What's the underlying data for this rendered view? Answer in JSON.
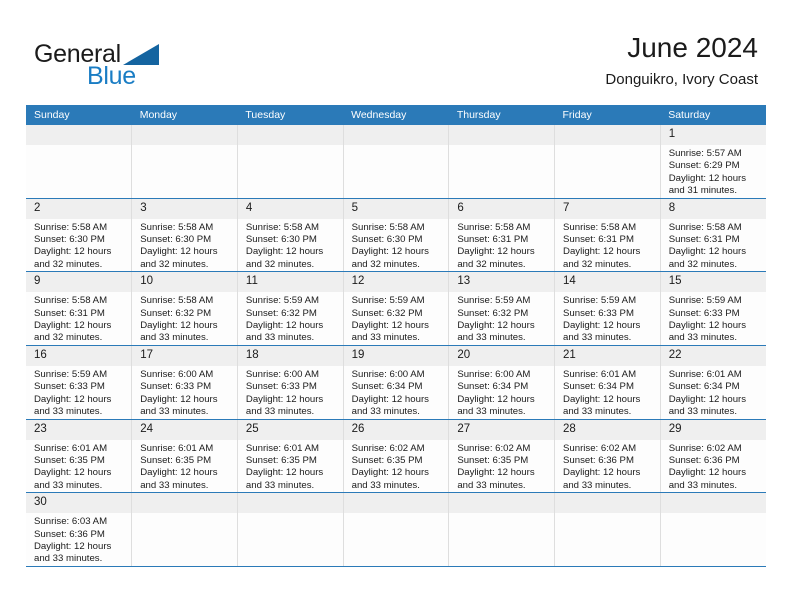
{
  "brand": {
    "name_top": "General",
    "name_bottom": "Blue",
    "accent_color": "#1a7dc4",
    "triangle_color": "#1464a0"
  },
  "header": {
    "title": "June 2024",
    "subtitle": "Donguikro, Ivory Coast"
  },
  "theme": {
    "header_row_bg": "#2b7ab8",
    "header_row_text": "#ffffff",
    "daynum_bg": "#efefef",
    "cell_bg": "#fdfdfd",
    "row_divider": "#2b7ab8",
    "column_divider": "#dedede"
  },
  "labels": {
    "sunrise": "Sunrise:",
    "sunset": "Sunset:",
    "daylight": "Daylight:"
  },
  "weekdays": [
    "Sunday",
    "Monday",
    "Tuesday",
    "Wednesday",
    "Thursday",
    "Friday",
    "Saturday"
  ],
  "weeks": [
    [
      {
        "day": "",
        "blank": true
      },
      {
        "day": "",
        "blank": true
      },
      {
        "day": "",
        "blank": true
      },
      {
        "day": "",
        "blank": true
      },
      {
        "day": "",
        "blank": true
      },
      {
        "day": "",
        "blank": true
      },
      {
        "day": "1",
        "sunrise": "Sunrise: 5:57 AM",
        "sunset": "Sunset: 6:29 PM",
        "daylight": "Daylight: 12 hours and 31 minutes."
      }
    ],
    [
      {
        "day": "2",
        "sunrise": "Sunrise: 5:58 AM",
        "sunset": "Sunset: 6:30 PM",
        "daylight": "Daylight: 12 hours and 32 minutes."
      },
      {
        "day": "3",
        "sunrise": "Sunrise: 5:58 AM",
        "sunset": "Sunset: 6:30 PM",
        "daylight": "Daylight: 12 hours and 32 minutes."
      },
      {
        "day": "4",
        "sunrise": "Sunrise: 5:58 AM",
        "sunset": "Sunset: 6:30 PM",
        "daylight": "Daylight: 12 hours and 32 minutes."
      },
      {
        "day": "5",
        "sunrise": "Sunrise: 5:58 AM",
        "sunset": "Sunset: 6:30 PM",
        "daylight": "Daylight: 12 hours and 32 minutes."
      },
      {
        "day": "6",
        "sunrise": "Sunrise: 5:58 AM",
        "sunset": "Sunset: 6:31 PM",
        "daylight": "Daylight: 12 hours and 32 minutes."
      },
      {
        "day": "7",
        "sunrise": "Sunrise: 5:58 AM",
        "sunset": "Sunset: 6:31 PM",
        "daylight": "Daylight: 12 hours and 32 minutes."
      },
      {
        "day": "8",
        "sunrise": "Sunrise: 5:58 AM",
        "sunset": "Sunset: 6:31 PM",
        "daylight": "Daylight: 12 hours and 32 minutes."
      }
    ],
    [
      {
        "day": "9",
        "sunrise": "Sunrise: 5:58 AM",
        "sunset": "Sunset: 6:31 PM",
        "daylight": "Daylight: 12 hours and 32 minutes."
      },
      {
        "day": "10",
        "sunrise": "Sunrise: 5:58 AM",
        "sunset": "Sunset: 6:32 PM",
        "daylight": "Daylight: 12 hours and 33 minutes."
      },
      {
        "day": "11",
        "sunrise": "Sunrise: 5:59 AM",
        "sunset": "Sunset: 6:32 PM",
        "daylight": "Daylight: 12 hours and 33 minutes."
      },
      {
        "day": "12",
        "sunrise": "Sunrise: 5:59 AM",
        "sunset": "Sunset: 6:32 PM",
        "daylight": "Daylight: 12 hours and 33 minutes."
      },
      {
        "day": "13",
        "sunrise": "Sunrise: 5:59 AM",
        "sunset": "Sunset: 6:32 PM",
        "daylight": "Daylight: 12 hours and 33 minutes."
      },
      {
        "day": "14",
        "sunrise": "Sunrise: 5:59 AM",
        "sunset": "Sunset: 6:33 PM",
        "daylight": "Daylight: 12 hours and 33 minutes."
      },
      {
        "day": "15",
        "sunrise": "Sunrise: 5:59 AM",
        "sunset": "Sunset: 6:33 PM",
        "daylight": "Daylight: 12 hours and 33 minutes."
      }
    ],
    [
      {
        "day": "16",
        "sunrise": "Sunrise: 5:59 AM",
        "sunset": "Sunset: 6:33 PM",
        "daylight": "Daylight: 12 hours and 33 minutes."
      },
      {
        "day": "17",
        "sunrise": "Sunrise: 6:00 AM",
        "sunset": "Sunset: 6:33 PM",
        "daylight": "Daylight: 12 hours and 33 minutes."
      },
      {
        "day": "18",
        "sunrise": "Sunrise: 6:00 AM",
        "sunset": "Sunset: 6:33 PM",
        "daylight": "Daylight: 12 hours and 33 minutes."
      },
      {
        "day": "19",
        "sunrise": "Sunrise: 6:00 AM",
        "sunset": "Sunset: 6:34 PM",
        "daylight": "Daylight: 12 hours and 33 minutes."
      },
      {
        "day": "20",
        "sunrise": "Sunrise: 6:00 AM",
        "sunset": "Sunset: 6:34 PM",
        "daylight": "Daylight: 12 hours and 33 minutes."
      },
      {
        "day": "21",
        "sunrise": "Sunrise: 6:01 AM",
        "sunset": "Sunset: 6:34 PM",
        "daylight": "Daylight: 12 hours and 33 minutes."
      },
      {
        "day": "22",
        "sunrise": "Sunrise: 6:01 AM",
        "sunset": "Sunset: 6:34 PM",
        "daylight": "Daylight: 12 hours and 33 minutes."
      }
    ],
    [
      {
        "day": "23",
        "sunrise": "Sunrise: 6:01 AM",
        "sunset": "Sunset: 6:35 PM",
        "daylight": "Daylight: 12 hours and 33 minutes."
      },
      {
        "day": "24",
        "sunrise": "Sunrise: 6:01 AM",
        "sunset": "Sunset: 6:35 PM",
        "daylight": "Daylight: 12 hours and 33 minutes."
      },
      {
        "day": "25",
        "sunrise": "Sunrise: 6:01 AM",
        "sunset": "Sunset: 6:35 PM",
        "daylight": "Daylight: 12 hours and 33 minutes."
      },
      {
        "day": "26",
        "sunrise": "Sunrise: 6:02 AM",
        "sunset": "Sunset: 6:35 PM",
        "daylight": "Daylight: 12 hours and 33 minutes."
      },
      {
        "day": "27",
        "sunrise": "Sunrise: 6:02 AM",
        "sunset": "Sunset: 6:35 PM",
        "daylight": "Daylight: 12 hours and 33 minutes."
      },
      {
        "day": "28",
        "sunrise": "Sunrise: 6:02 AM",
        "sunset": "Sunset: 6:36 PM",
        "daylight": "Daylight: 12 hours and 33 minutes."
      },
      {
        "day": "29",
        "sunrise": "Sunrise: 6:02 AM",
        "sunset": "Sunset: 6:36 PM",
        "daylight": "Daylight: 12 hours and 33 minutes."
      }
    ],
    [
      {
        "day": "30",
        "sunrise": "Sunrise: 6:03 AM",
        "sunset": "Sunset: 6:36 PM",
        "daylight": "Daylight: 12 hours and 33 minutes."
      },
      {
        "day": "",
        "blank": true
      },
      {
        "day": "",
        "blank": true
      },
      {
        "day": "",
        "blank": true
      },
      {
        "day": "",
        "blank": true
      },
      {
        "day": "",
        "blank": true
      },
      {
        "day": "",
        "blank": true
      }
    ]
  ]
}
